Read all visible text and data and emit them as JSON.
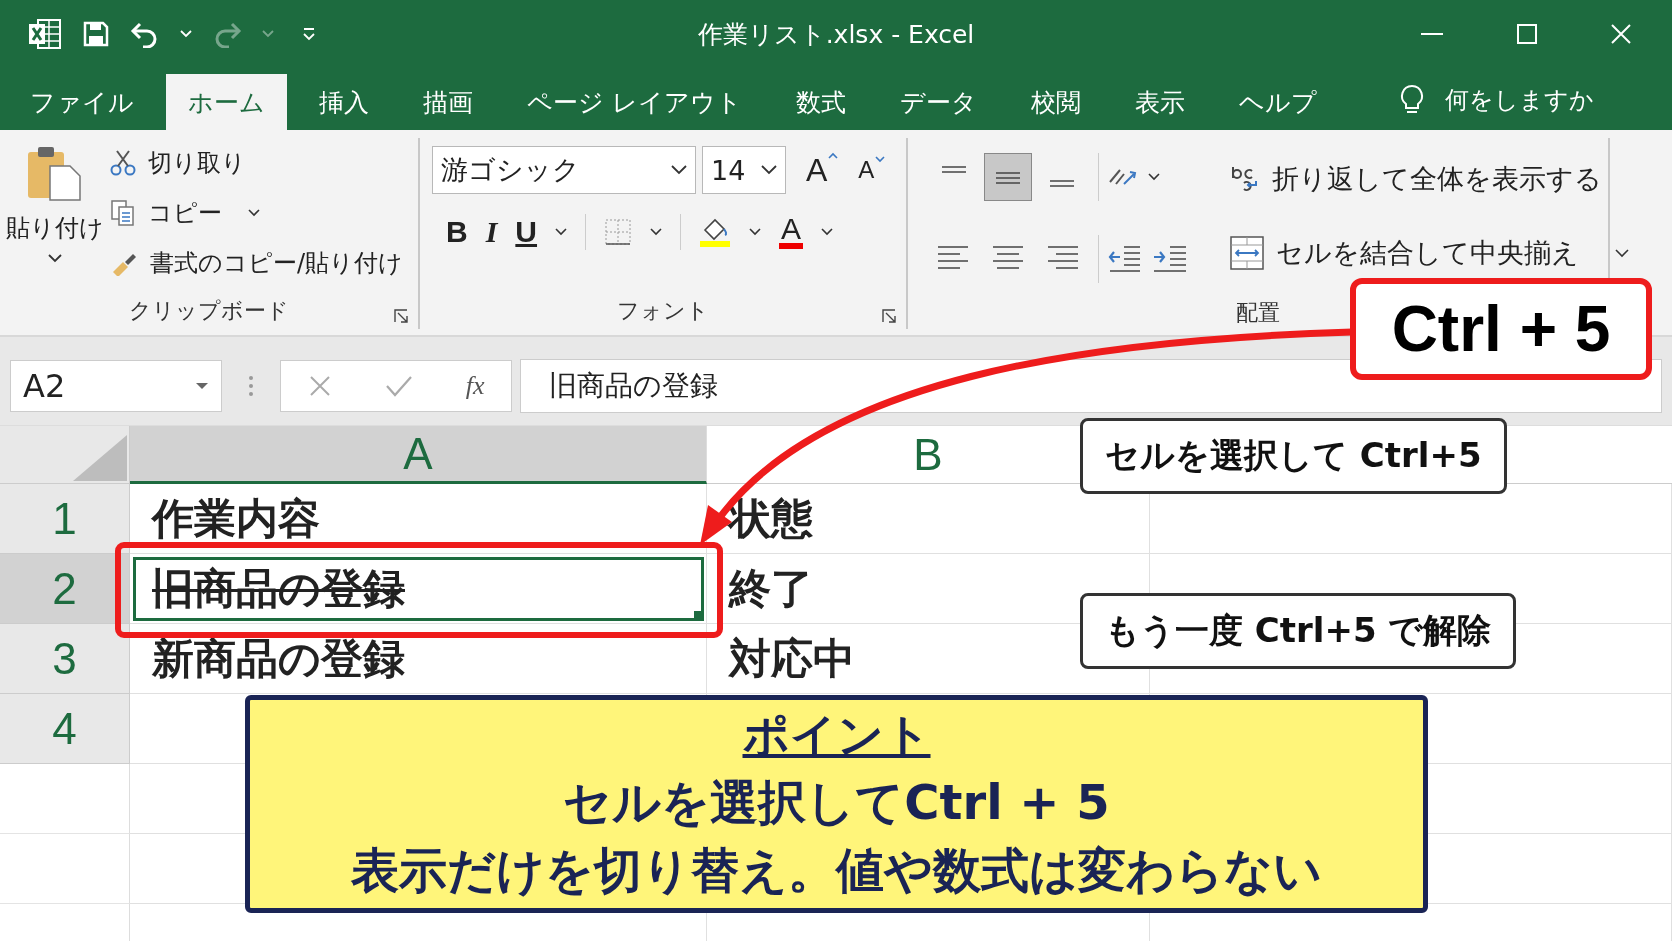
{
  "window": {
    "title": "作業リスト.xlsx  -  Excel"
  },
  "quick_access": {
    "redo": {
      "disabled": true
    }
  },
  "tabs": [
    {
      "label": "ファイル",
      "selected": false
    },
    {
      "label": "ホーム",
      "selected": true
    },
    {
      "label": "挿入",
      "selected": false
    },
    {
      "label": "描画",
      "selected": false
    },
    {
      "label": "ページ レイアウト",
      "selected": false
    },
    {
      "label": "数式",
      "selected": false
    },
    {
      "label": "データ",
      "selected": false
    },
    {
      "label": "校閲",
      "selected": false
    },
    {
      "label": "表示",
      "selected": false
    },
    {
      "label": "ヘルプ",
      "selected": false
    }
  ],
  "tell_me": "何をしますか",
  "ribbon": {
    "clipboard": {
      "paste": "貼り付け",
      "cut": "切り取り",
      "copy": "コピー",
      "format_painter": "書式のコピー/貼り付け",
      "label": "クリップボード"
    },
    "font": {
      "name": "游ゴシック",
      "size": "14",
      "grow": "A",
      "shrink": "A",
      "bold": "B",
      "italic": "I",
      "underline": "U",
      "font_color": "A",
      "label": "フォント"
    },
    "alignment": {
      "vertical": [
        {
          "kind": "top",
          "selected": false
        },
        {
          "kind": "middle",
          "selected": true
        },
        {
          "kind": "bottom",
          "selected": false
        }
      ],
      "wrap_text": "折り返して全体を表示する",
      "merge": "セルを結合して中央揃え",
      "label": "配置"
    }
  },
  "formula_bar": {
    "name_box": "A2",
    "function": "fx",
    "value": "旧商品の登録"
  },
  "sheet": {
    "columns": [
      {
        "label": "A",
        "selected": true
      },
      {
        "label": "B",
        "selected": false
      }
    ],
    "rows": [
      {
        "number": "1",
        "selected": false,
        "cells": [
          {
            "text": "作業内容",
            "strikethrough": false,
            "active": false
          },
          {
            "text": "状態",
            "strikethrough": false,
            "active": false
          }
        ]
      },
      {
        "number": "2",
        "selected": true,
        "cells": [
          {
            "text": "旧商品の登録",
            "strikethrough": true,
            "active": true
          },
          {
            "text": "終了",
            "strikethrough": false,
            "active": false
          }
        ]
      },
      {
        "number": "3",
        "selected": false,
        "cells": [
          {
            "text": "新商品の登録",
            "strikethrough": false,
            "active": false
          },
          {
            "text": "対応中",
            "strikethrough": false,
            "active": false
          }
        ]
      },
      {
        "number": "4",
        "selected": false,
        "cells": []
      }
    ]
  },
  "annotations": {
    "shortcut": "Ctrl + 5",
    "callouts": [
      "セルを選択して Ctrl+5",
      "もう一度 Ctrl+5 で解除"
    ],
    "point": {
      "title": "ポイント",
      "lines": [
        "セルを選択してCtrl + 5",
        "表示だけを切り替え。値や数式は変わらない"
      ]
    }
  }
}
